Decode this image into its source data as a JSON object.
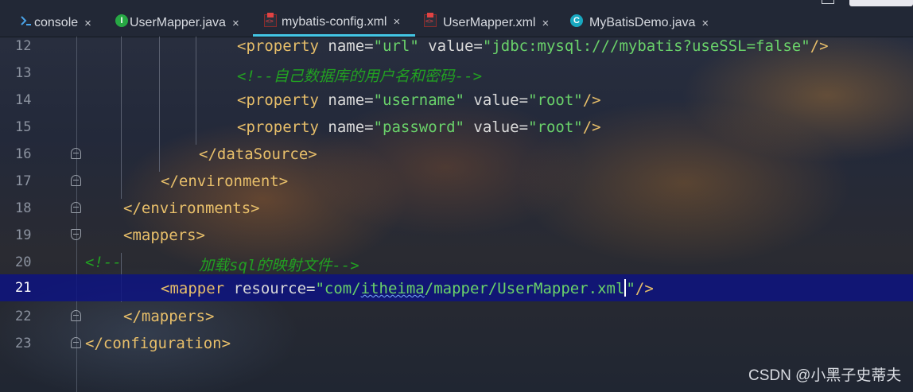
{
  "tabs": [
    {
      "label": "console",
      "icon": "console-icon",
      "active": false
    },
    {
      "label": "UserMapper.java",
      "icon": "interface-java-icon",
      "active": false
    },
    {
      "label": "mybatis-config.xml",
      "icon": "xml-file-icon",
      "active": true
    },
    {
      "label": "UserMapper.xml",
      "icon": "xml-file-icon",
      "active": false
    },
    {
      "label": "MyBatisDemo.java",
      "icon": "class-java-icon",
      "active": false
    }
  ],
  "close_glyph": "×",
  "lines": [
    {
      "num": "12",
      "p1": "<property ",
      "p2": "name=",
      "p3": "\"url\"",
      "p4": " value=",
      "p5": "\"jdbc:mysql:///mybatis?useSSL=false\"",
      "p6": "/>"
    },
    {
      "num": "13",
      "comment": "<!--自己数据库的用户名和密码-->"
    },
    {
      "num": "14",
      "p1": "<property ",
      "p2": "name=",
      "p3": "\"username\"",
      "p4": " value=",
      "p5": "\"root\"",
      "p6": "/>"
    },
    {
      "num": "15",
      "p1": "<property ",
      "p2": "name=",
      "p3": "\"password\"",
      "p4": " value=",
      "p5": "\"root\"",
      "p6": "/>"
    },
    {
      "num": "16",
      "tag": "</dataSource>"
    },
    {
      "num": "17",
      "tag": "</environment>"
    },
    {
      "num": "18",
      "tag": "</environments>"
    },
    {
      "num": "19",
      "tag": "<mappers>"
    },
    {
      "num": "20",
      "c1": "<!--",
      "c2": "加载sql的映射文件-->"
    },
    {
      "num": "21",
      "t1": "<mapper ",
      "a1": "resource=",
      "v1": "\"com/",
      "v2": "itheima",
      "v3": "/mapper/UserMapper.xml",
      "v4": "\"",
      "t2": "/>"
    },
    {
      "num": "22",
      "tag": "</mappers>"
    },
    {
      "num": "23",
      "tag": "</configuration>"
    }
  ],
  "colors": {
    "current_line": "#0c1282",
    "tag": "#e8bf6a",
    "string": "#6ad26a",
    "comment": "#22a022",
    "tab_underline": "#43c5e4"
  },
  "watermark": "CSDN @小黑子史蒂夫"
}
